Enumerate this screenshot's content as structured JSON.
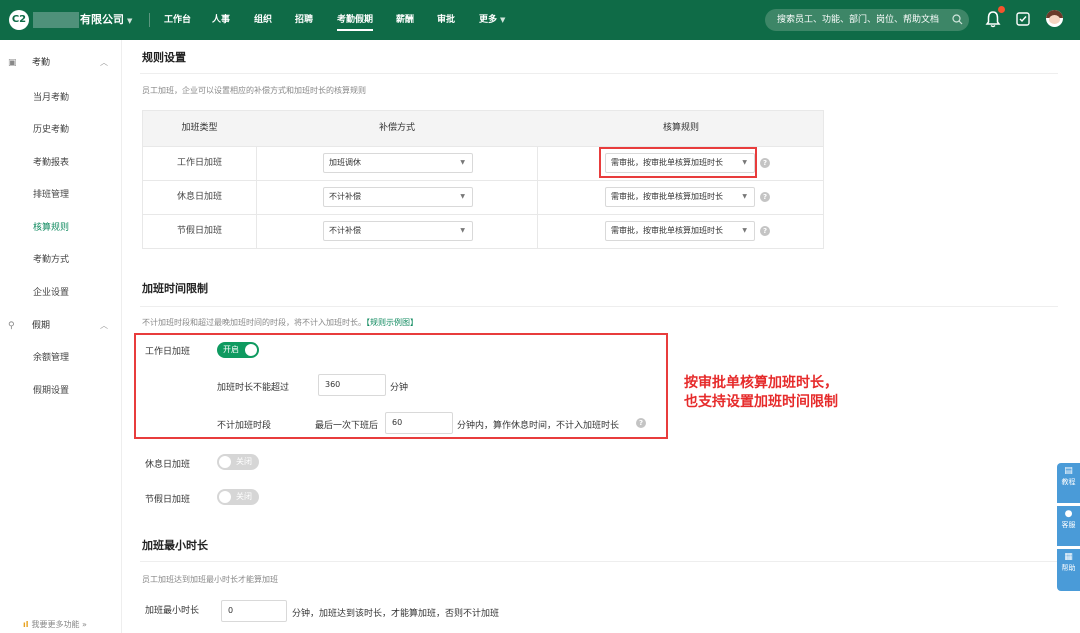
{
  "topbar": {
    "logo_text": "C2",
    "company": "有限公司",
    "nav": [
      "工作台",
      "人事",
      "组织",
      "招聘",
      "考勤假期",
      "薪酬",
      "审批",
      "更多"
    ],
    "search_placeholder": "搜索员工、功能、部门、岗位、帮助文档",
    "brand_color": "#0f6b47"
  },
  "sidebar": {
    "group1": "考勤",
    "items1": [
      "当月考勤",
      "历史考勤",
      "考勤报表",
      "排班管理",
      "核算规则",
      "考勤方式",
      "企业设置"
    ],
    "group2": "假期",
    "items2": [
      "余额管理",
      "假期设置"
    ],
    "footer": "我要更多功能"
  },
  "rules": {
    "title": "规则设置",
    "desc": "员工加班，企业可以设置相应的补偿方式和加班时长的核算规则",
    "headers": [
      "加班类型",
      "补偿方式",
      "核算规则"
    ],
    "rows": [
      {
        "type": "工作日加班",
        "comp": "加班调休",
        "rule": "需审批，按审批单核算加班时长"
      },
      {
        "type": "休息日加班",
        "comp": "不计补偿",
        "rule": "需审批，按审批单核算加班时长"
      },
      {
        "type": "节假日加班",
        "comp": "不计补偿",
        "rule": "需审批，按审批单核算加班时长"
      }
    ]
  },
  "limit": {
    "title": "加班时间限制",
    "desc": "不计加班时段和超过最晚加班时间的时段，将不计入加班时长。",
    "desc_link": "【规则示例图】",
    "workday": {
      "label": "工作日加班",
      "toggle": "开启",
      "max_label": "加班时长不能超过",
      "max_value": "360",
      "max_unit": "分钟",
      "exclude_label": "不计加班时段",
      "after_label": "最后一次下班后",
      "after_value": "60",
      "after_suffix": "分钟内，算作休息时间，不计入加班时长"
    },
    "restday": {
      "label": "休息日加班",
      "toggle": "关闭"
    },
    "holiday": {
      "label": "节假日加班",
      "toggle": "关闭"
    }
  },
  "annotation": {
    "line1": "按审批单核算加班时长，",
    "line2": "也支持设置加班时间限制"
  },
  "min": {
    "title": "加班最小时长",
    "desc": "员工加班达到加班最小时长才能算加班",
    "label": "加班最小时长",
    "value": "0",
    "suffix": "分钟，加班达到该时长，才能算加班，否则不计加班"
  },
  "right_tabs": [
    "教程",
    "客服",
    "帮助"
  ]
}
